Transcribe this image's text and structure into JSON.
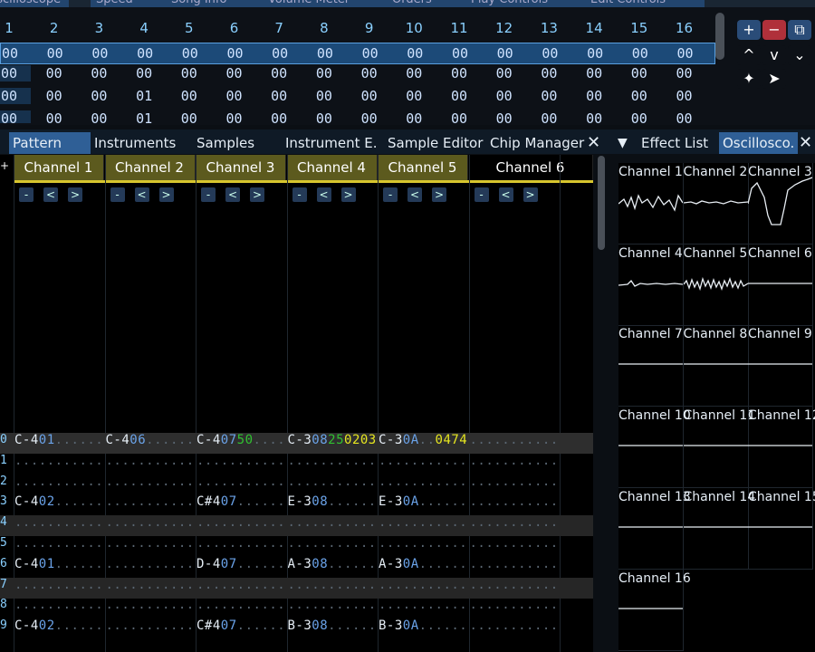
{
  "top_tabs": [
    "Oscilloscope",
    "Speed",
    "Song Info",
    "Volume Meter",
    "Orders",
    "Play Controls",
    "Edit Controls"
  ],
  "orders": {
    "columns": [
      "1",
      "2",
      "3",
      "4",
      "5",
      "6",
      "7",
      "8",
      "9",
      "10",
      "11",
      "12",
      "13",
      "14",
      "15",
      "16"
    ],
    "rows": [
      [
        "00",
        "00",
        "00",
        "00",
        "00",
        "00",
        "00",
        "00",
        "00",
        "00",
        "00",
        "00",
        "00",
        "00",
        "00",
        "00"
      ],
      [
        "00",
        "00",
        "00",
        "00",
        "00",
        "00",
        "00",
        "00",
        "00",
        "00",
        "00",
        "00",
        "00",
        "00",
        "00",
        "00"
      ],
      [
        "00",
        "00",
        "00",
        "01",
        "00",
        "00",
        "00",
        "00",
        "00",
        "00",
        "00",
        "00",
        "00",
        "00",
        "00",
        "00"
      ]
    ]
  },
  "controls": {
    "add": "+",
    "remove": "−",
    "duplicate": "⧉",
    "up": "^",
    "down": "v",
    "more": "⌄",
    "magic": "✦",
    "pointer": "➤"
  },
  "panel_tabs": [
    "Pattern",
    "Instruments",
    "Samples",
    "Instrument E.",
    "Sample Editor",
    "Chip Manager"
  ],
  "panel_close": "✕",
  "right_tabs": {
    "menu": "▼",
    "items": [
      "Effect List",
      "Oscillosco."
    ],
    "close": "✕"
  },
  "channels": [
    "Channel 1",
    "Channel 2",
    "Channel 3",
    "Channel 4",
    "Channel 5",
    "Channel 6"
  ],
  "channel_buttons": [
    "-",
    "<",
    ">"
  ],
  "pattern_rows": [
    {
      "num": "0",
      "cells": [
        [
          "C-4",
          "01",
          "",
          ""
        ],
        [
          "C-4",
          "06",
          "",
          ""
        ],
        [
          "C-4",
          "07",
          "50",
          ""
        ],
        [
          "C-3",
          "08",
          "25",
          "0203"
        ],
        [
          "C-3",
          "0A",
          "",
          "0474"
        ],
        [
          "",
          "",
          "",
          ""
        ]
      ]
    },
    {
      "num": "1",
      "cells": [
        [
          "",
          "",
          "",
          ""
        ],
        [
          "",
          "",
          "",
          ""
        ],
        [
          "",
          "",
          "",
          ""
        ],
        [
          "",
          "",
          "",
          ""
        ],
        [
          "",
          "",
          "",
          ""
        ],
        [
          "",
          "",
          "",
          ""
        ]
      ]
    },
    {
      "num": "2",
      "cells": [
        [
          "",
          "",
          "",
          ""
        ],
        [
          "",
          "",
          "",
          ""
        ],
        [
          "",
          "",
          "",
          ""
        ],
        [
          "",
          "",
          "",
          ""
        ],
        [
          "",
          "",
          "",
          ""
        ],
        [
          "",
          "",
          "",
          ""
        ]
      ]
    },
    {
      "num": "3",
      "cells": [
        [
          "C-4",
          "02",
          "",
          ""
        ],
        [
          "",
          "",
          "",
          ""
        ],
        [
          "C#4",
          "07",
          "",
          ""
        ],
        [
          "E-3",
          "08",
          "",
          ""
        ],
        [
          "E-3",
          "0A",
          "",
          ""
        ],
        [
          "",
          "",
          "",
          ""
        ]
      ]
    },
    {
      "num": "4",
      "cells": [
        [
          "",
          "",
          "",
          ""
        ],
        [
          "",
          "",
          "",
          ""
        ],
        [
          "",
          "",
          "",
          ""
        ],
        [
          "",
          "",
          "",
          ""
        ],
        [
          "",
          "",
          "",
          ""
        ],
        [
          "",
          "",
          "",
          ""
        ]
      ]
    },
    {
      "num": "5",
      "cells": [
        [
          "",
          "",
          "",
          ""
        ],
        [
          "",
          "",
          "",
          ""
        ],
        [
          "",
          "",
          "",
          ""
        ],
        [
          "",
          "",
          "",
          ""
        ],
        [
          "",
          "",
          "",
          ""
        ],
        [
          "",
          "",
          "",
          ""
        ]
      ]
    },
    {
      "num": "6",
      "cells": [
        [
          "C-4",
          "01",
          "",
          ""
        ],
        [
          "",
          "",
          "",
          ""
        ],
        [
          "D-4",
          "07",
          "",
          ""
        ],
        [
          "A-3",
          "08",
          "",
          ""
        ],
        [
          "A-3",
          "0A",
          "",
          ""
        ],
        [
          "",
          "",
          "",
          ""
        ]
      ]
    },
    {
      "num": "7",
      "cells": [
        [
          "",
          "",
          "",
          ""
        ],
        [
          "",
          "",
          "",
          ""
        ],
        [
          "",
          "",
          "",
          ""
        ],
        [
          "",
          "",
          "",
          ""
        ],
        [
          "",
          "",
          "",
          ""
        ],
        [
          "",
          "",
          "",
          ""
        ]
      ]
    },
    {
      "num": "8",
      "cells": [
        [
          "",
          "",
          "",
          ""
        ],
        [
          "",
          "",
          "",
          ""
        ],
        [
          "",
          "",
          "",
          ""
        ],
        [
          "",
          "",
          "",
          ""
        ],
        [
          "",
          "",
          "",
          ""
        ],
        [
          "",
          "",
          "",
          ""
        ]
      ]
    },
    {
      "num": "9",
      "cells": [
        [
          "C-4",
          "02",
          "",
          ""
        ],
        [
          "",
          "",
          "",
          ""
        ],
        [
          "C#4",
          "07",
          "",
          ""
        ],
        [
          "B-3",
          "08",
          "",
          ""
        ],
        [
          "B-3",
          "0A",
          "",
          ""
        ],
        [
          "",
          "",
          "",
          ""
        ]
      ]
    }
  ],
  "oscilloscopes": [
    "Channel 1",
    "Channel 2",
    "Channel 3",
    "Channel 4",
    "Channel 5",
    "Channel 6",
    "Channel 7",
    "Channel 8",
    "Channel 9",
    "Channel 10",
    "Channel 11",
    "Channel 12",
    "Channel 13",
    "Channel 14",
    "Channel 15",
    "Channel 16"
  ]
}
